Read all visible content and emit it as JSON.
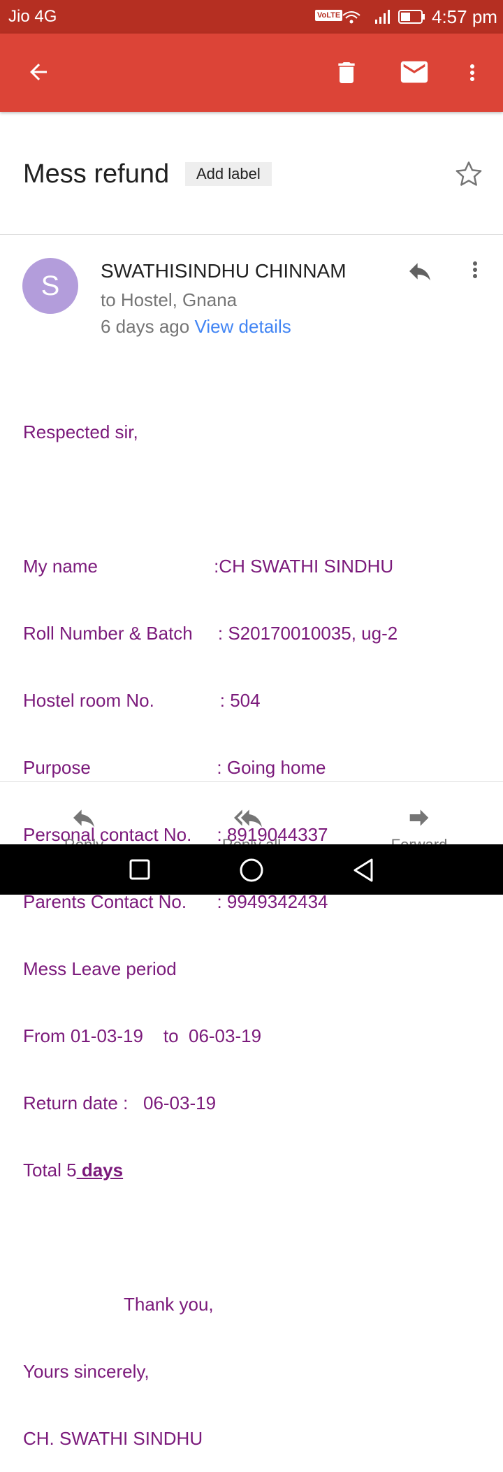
{
  "status": {
    "carrier": "Jio 4G",
    "volte": "VoLTE",
    "time": "4:57 pm"
  },
  "appbar": {
    "back_icon": "arrow-back-icon",
    "delete_icon": "trash-icon",
    "mark_unread_icon": "mail-icon",
    "more_icon": "more-vert-icon"
  },
  "thread": {
    "subject": "Mess refund",
    "add_label": "Add label"
  },
  "message": {
    "avatar_letter": "S",
    "sender": "SWATHISINDHU CHINNAM",
    "recipients": "to Hostel, Gnana",
    "time_ago": "6 days ago",
    "view_details": "View details",
    "body": {
      "greeting": "Respected sir,",
      "l1": "My name                       :CH SWATHI SINDHU",
      "l2": "Roll Number & Batch     : S20170010035, ug-2",
      "l3": "Hostel room No.             : 504",
      "l4": "Purpose                         : Going home",
      "l5": "Personal contact No.     : 8919044337",
      "l6": "Parents Contact No.      : 9949342434",
      "l7": "Mess Leave period",
      "l8": "From 01-03-19    to  06-03-19",
      "l9": "Return date :   06-03-19",
      "l10a": "Total 5",
      "l10b": " days",
      "thanks": "                    Thank you,",
      "closing": "Yours sincerely,",
      "signature": "CH. SWATHI SINDHU"
    }
  },
  "actions": {
    "reply": "Reply",
    "reply_all": "Reply all",
    "forward": "Forward"
  },
  "colors": {
    "appbar": "#dc4437",
    "statusbar": "#b52f22",
    "body_text": "#7b1a7b",
    "link": "#4285f4",
    "avatar": "#b39ddb"
  }
}
